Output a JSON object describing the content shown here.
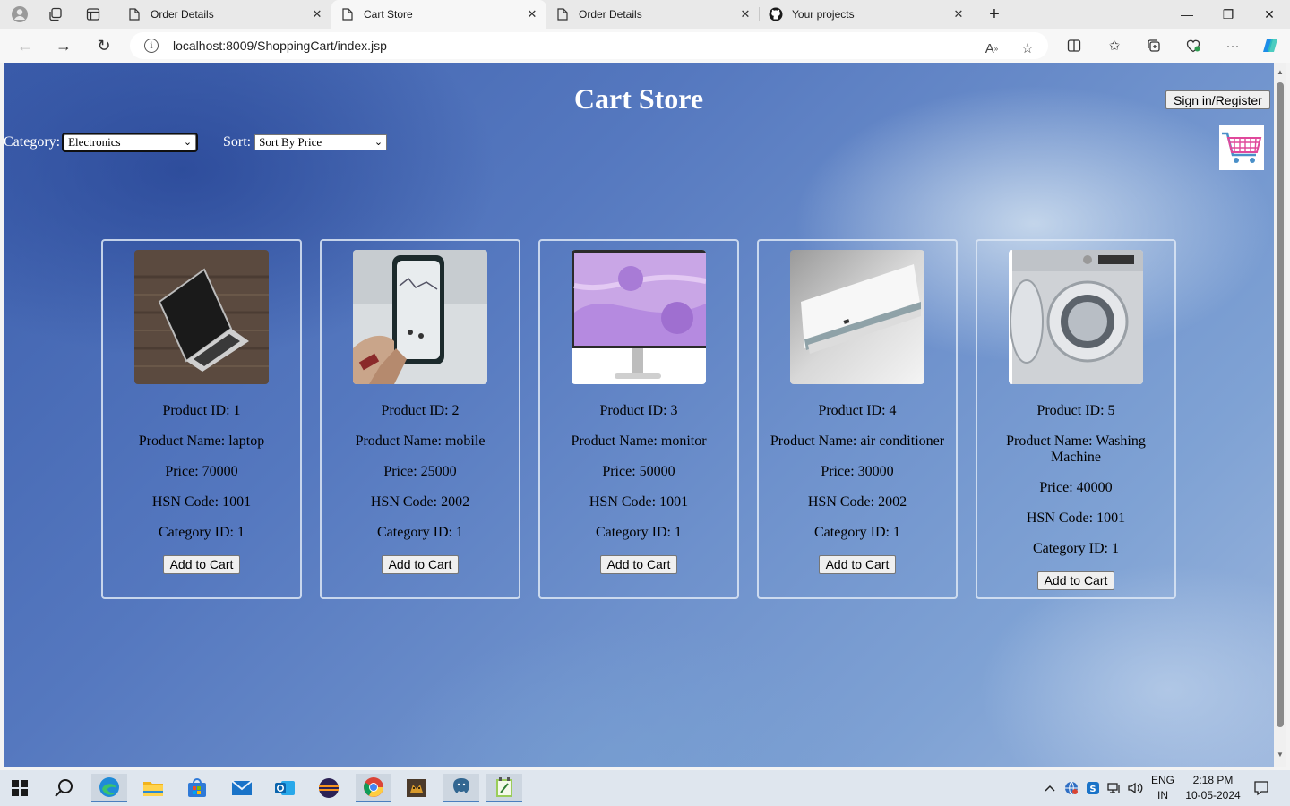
{
  "browser": {
    "tabs": [
      {
        "title": "Order Details",
        "active": false
      },
      {
        "title": "Cart Store",
        "active": true
      },
      {
        "title": "Order Details",
        "active": false
      },
      {
        "title": "Your projects",
        "active": false
      }
    ],
    "url": "localhost:8009/ShoppingCart/index.jsp"
  },
  "page": {
    "title": "Cart Store",
    "signin_label": "Sign in/Register",
    "category_label": "Category:",
    "category_value": "Electronics",
    "sort_label": "Sort:",
    "sort_value": "Sort By Price",
    "add_label": "Add to Cart"
  },
  "products": [
    {
      "id": "Product ID: 1",
      "name": "Product Name: laptop",
      "price": "Price: 70000",
      "hsn": "HSN Code: 1001",
      "cat": "Category ID: 1",
      "image": "laptop"
    },
    {
      "id": "Product ID: 2",
      "name": "Product Name: mobile",
      "price": "Price: 25000",
      "hsn": "HSN Code: 2002",
      "cat": "Category ID: 1",
      "image": "mobile"
    },
    {
      "id": "Product ID: 3",
      "name": "Product Name: monitor",
      "price": "Price: 50000",
      "hsn": "HSN Code: 1001",
      "cat": "Category ID: 1",
      "image": "monitor"
    },
    {
      "id": "Product ID: 4",
      "name": "Product Name: air conditioner",
      "price": "Price: 30000",
      "hsn": "HSN Code: 2002",
      "cat": "Category ID: 1",
      "image": "air-conditioner"
    },
    {
      "id": "Product ID: 5",
      "name": "Product Name: Washing Machine",
      "price": "Price: 40000",
      "hsn": "HSN Code: 1001",
      "cat": "Category ID: 1",
      "image": "washing-machine"
    }
  ],
  "taskbar": {
    "lang_top": "ENG",
    "lang_bottom": "IN",
    "time": "2:18 PM",
    "date": "10-05-2024"
  }
}
